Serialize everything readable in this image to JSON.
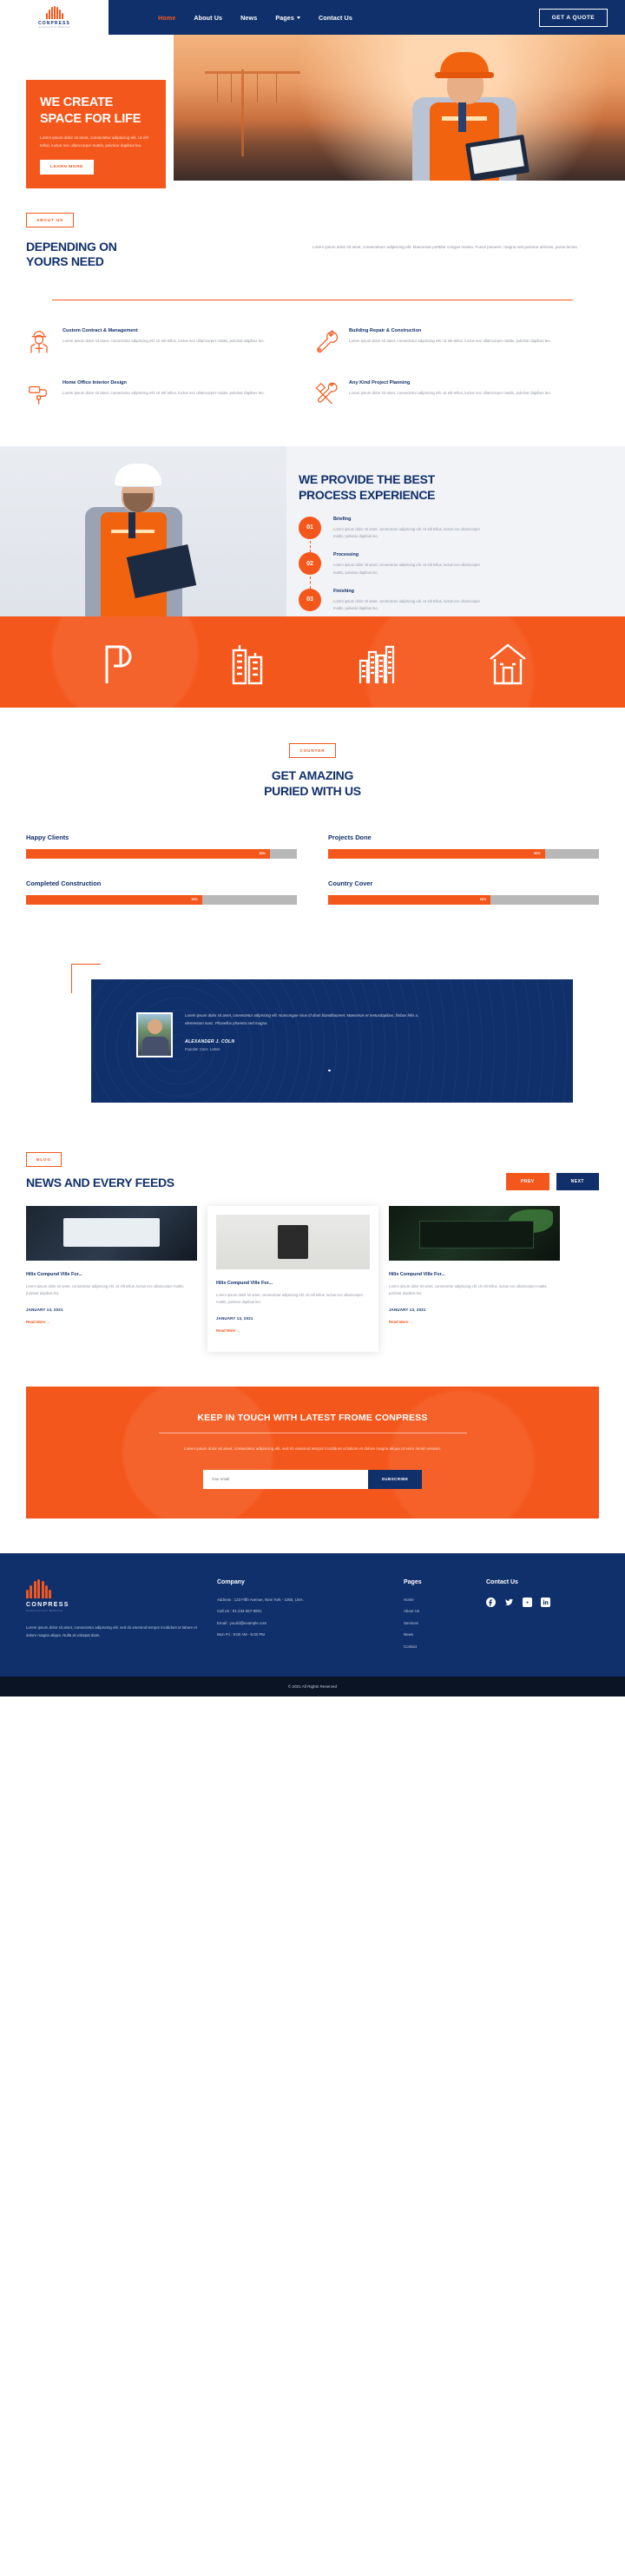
{
  "brand": {
    "name": "CONPRESS",
    "tagline": "Construction Website",
    "accent": "#f4571c",
    "navy": "#10306b"
  },
  "header": {
    "nav": [
      {
        "label": "Home",
        "active": true
      },
      {
        "label": "About Us",
        "active": false
      },
      {
        "label": "News",
        "active": false
      },
      {
        "label": "Pages",
        "active": false,
        "has_caret": true
      },
      {
        "label": "Contact Us",
        "active": false
      }
    ],
    "cta": "GET A QUOTE"
  },
  "hero": {
    "title_line1": "WE CREATE",
    "title_line2": "SPACE FOR LIFE",
    "paragraph": "Lorem ipsum dolor sit amet, consectetur adipiscing elit. Ut elit tellus, luctus nec ullamcorper mattis, pulvinar dapibus leo.",
    "button": "LEARN MORE"
  },
  "about": {
    "tag": "ABOUT US",
    "title_line1": "DEPENDING ON",
    "title_line2": "YOURS NEED",
    "paragraph": "Lorem ipsum dolor sit amet, consectetuer adipiscing elit. Maecenas porttitor congue massa. Fusce posuere, magna sed pulvinar ultricies, purus lectus.",
    "features": [
      {
        "icon": "worker-helmet-icon",
        "title": "Custom Contract & Management",
        "text": "Lorem ipsum dolor sit amet, consectetur adipiscing elit. Ut elit tellus, luctus nec ullamcorper mattis, pulvinar dapibus leo."
      },
      {
        "icon": "wrench-icon",
        "title": "Building Repair & Construction",
        "text": "Lorem ipsum dolor sit amet, consectetur adipiscing elit. Ut elit tellus, luctus nec ullamcorper mattis, pulvinar dapibus leo."
      },
      {
        "icon": "paint-roller-icon",
        "title": "Home Office Interior Design",
        "text": "Lorem ipsum dolor sit amet, consectetur adipiscing elit. Ut elit tellus, luctus nec ullamcorper mattis, pulvinar dapibus leo."
      },
      {
        "icon": "hammer-wrench-icon",
        "title": "Any Kind Project Planning",
        "text": "Lorem ipsum dolor sit amet, consectetur adipiscing elit. Ut elit tellus, luctus nec ullamcorper mattis, pulvinar dapibus leo."
      }
    ]
  },
  "process": {
    "title_line1": "WE PROVIDE THE BEST",
    "title_line2": "PROCESS EXPERIENCE",
    "steps": [
      {
        "num": "01",
        "title": "Briefing",
        "text": "Lorem ipsum dolor sit amet, consectetur adipiscing elit. Ut elit tellus, luctus nec ullamcorper mattis, pulvinar dapibus leo."
      },
      {
        "num": "02",
        "title": "Processing",
        "text": "Lorem ipsum dolor sit amet, consectetur adipiscing elit. Ut elit tellus, luctus nec ullamcorper mattis, pulvinar dapibus leo."
      },
      {
        "num": "03",
        "title": "Finishing",
        "text": "Lorem ipsum dolor sit amet, consectetur adipiscing elit. Ut elit tellus, luctus nec ullamcorper mattis, pulvinar dapibus leo."
      }
    ]
  },
  "banner_icons": [
    "p-monogram-icon",
    "building-tower-icon",
    "skyline-icon",
    "house-icon"
  ],
  "counter": {
    "tag": "COUNTER",
    "title_line1": "GET AMAZING",
    "title_line2": "PURIED WITH US",
    "bars": [
      {
        "label": "Happy Clients",
        "percent": 90,
        "percent_label": "90%"
      },
      {
        "label": "Projects Done",
        "percent": 80,
        "percent_label": "80%"
      },
      {
        "label": "Completed Construction",
        "percent": 65,
        "percent_label": "65%"
      },
      {
        "label": "Country Cover",
        "percent": 60,
        "percent_label": "60%"
      }
    ]
  },
  "testimonial": {
    "quote": "Lorem ipsum dolor sit amet, consectetur adipiscing elit. Nuncongue risus id diam blanditiaoreet. Maecenas et metusdapibus, finibus felis a, elementum nunc. Phasellus pharetra sed magna.",
    "name": "ALEXANDER J. COLN",
    "role": "Founder Cons. Letem"
  },
  "blog": {
    "tag": "BLOG",
    "title": "NEWS AND EVERY FEEDS",
    "prev": "PREV",
    "next": "NEXT",
    "posts": [
      {
        "thumb": "tablet-dashboard-photo",
        "title": "Hilix Compund Ville For...",
        "text": "Lorem ipsum dolor sit amet, consectetur adipiscing elit. Ut elit tellus, luctus nec ullamcorper mattis, pulvinar dapibus leo.",
        "date": "JANUARY 13, 2021",
        "more": "Read More"
      },
      {
        "thumb": "tablet-hand-photo",
        "title": "Hilix Compund Ville For...",
        "text": "Lorem ipsum dolor sit amet, consectetur adipiscing elit. Ut elit tellus, luctus nec ullamcorper mattis, pulvinar dapibus leo.",
        "date": "JANUARY 13, 2021",
        "more": "Read More"
      },
      {
        "thumb": "code-screen-photo",
        "title": "Hilix Compund Ville For...",
        "text": "Lorem ipsum dolor sit amet, consectetur adipiscing elit. Ut elit tellus, luctus nec ullamcorper mattis, pulvinar dapibus leo.",
        "date": "JANUARY 13, 2021",
        "more": "Read More"
      }
    ]
  },
  "newsletter": {
    "title": "KEEP IN TOUCH WITH LATEST FROME CONPRESS",
    "paragraph": "Lorem ipsum dolor sit amet, consectetur adipiscing elit, sed do eiusmod tempor incididunt ut labore et dolore magna aliqua ut enim minim veniam.",
    "placeholder": "Your email",
    "button": "SUBSCRIBE"
  },
  "footer": {
    "about": "Lorem ipsum dolor sit amet, consectetur adipiscing elit, sed do eiusmod tempor incididunt ut labore et dolore magna aliqua. Nulla at volutpat diam.",
    "company": {
      "title": "Company",
      "items": [
        "Address : 123 Fifth Avenue, New York - 1050, USA.",
        "Call Us : 91-234-567-8901",
        "Email : yourid@example.com",
        "Mon Fri : 9:00 AM - 5:00 PM"
      ]
    },
    "pages": {
      "title": "Pages",
      "items": [
        "Home",
        "About Us",
        "Services",
        "News",
        "Contact"
      ]
    },
    "contact": {
      "title": "Contact Us",
      "socials": [
        "facebook-icon",
        "twitter-icon",
        "youtube-icon",
        "linkedin-icon"
      ]
    },
    "copyright": "© 2021 All Rights Reserved"
  }
}
